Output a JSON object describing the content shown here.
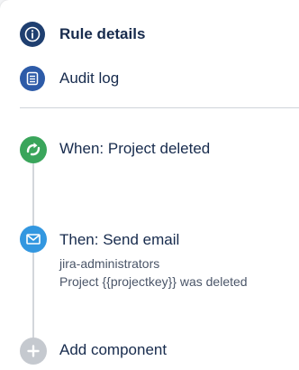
{
  "nav": {
    "rule_details_label": "Rule details",
    "audit_log_label": "Audit log"
  },
  "flow": {
    "trigger": {
      "label": "When: Project deleted",
      "icon": "trigger-arrow-icon"
    },
    "action": {
      "label": "Then: Send email",
      "icon": "envelope-icon",
      "recipient": "jira-administrators",
      "subject": "Project {{projectkey}} was deleted"
    },
    "add_component": {
      "label": "Add component",
      "icon": "plus-icon"
    }
  },
  "colors": {
    "nav_icon": "#2d5ba8",
    "nav_icon_active": "#1f3f70",
    "trigger": "#3aa55b",
    "action": "#3397e0",
    "add": "#c5c9cf",
    "text": "#172b4d"
  }
}
